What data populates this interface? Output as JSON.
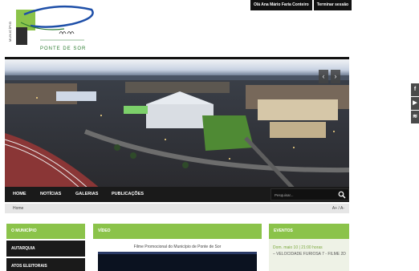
{
  "topbar": {
    "greeting": "Olá Ana Mário Faria Conteiro",
    "logout": "Terminar sessão"
  },
  "logo": {
    "vertical_text": "MUNICÍPIO",
    "town": "PONTE DE SOR"
  },
  "hero": {
    "prev": "‹",
    "next": "›"
  },
  "nav": {
    "items": [
      "HOME",
      "NOTÍCIAS",
      "GALERIAS",
      "PUBLICAÇÕES"
    ],
    "search_placeholder": "Pesquisar..."
  },
  "breadcrumb": {
    "home": "Home",
    "font_size": "A+ / A-"
  },
  "sidebar": {
    "header": "O MUNICÍPIO",
    "items": [
      "AUTARQUIA",
      "ATOS ELEITORAIS"
    ]
  },
  "video": {
    "header": "VÍDEO",
    "title": "Filme Promocional do Município de Ponte de Sor"
  },
  "events": {
    "header": "EVENTOS",
    "date": "Dom. maio 10 | 21:00 horas",
    "title": "– VELOCIDADE FURIOSA 7 - FILME 2D"
  },
  "social": {
    "icons": [
      "facebook-icon",
      "youtube-icon",
      "rss-icon"
    ]
  },
  "colors": {
    "accent": "#8bc34a",
    "dark": "#1a1a1a"
  }
}
